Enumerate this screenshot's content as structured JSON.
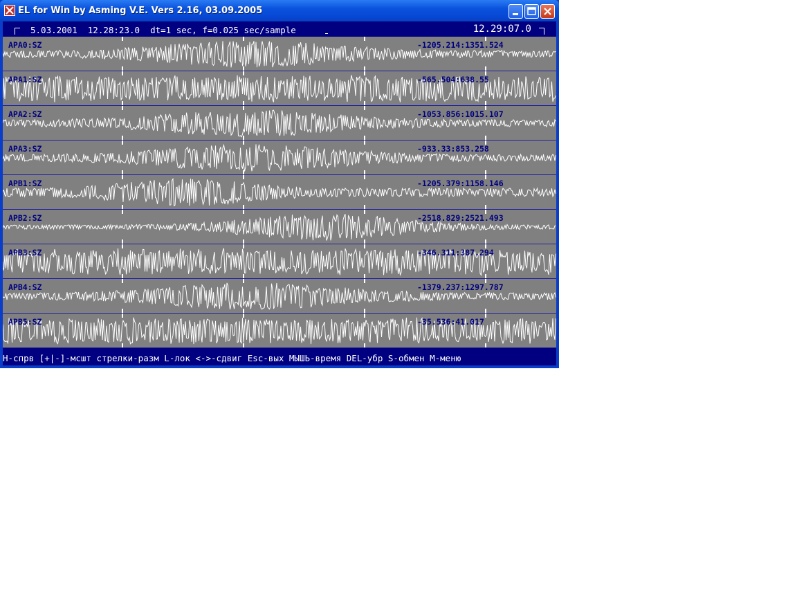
{
  "window": {
    "title": "EL for Win by Asming V.E. Vers 2.16, 03.09.2005"
  },
  "header": {
    "left": "5.03.2001  12.28:23.0  dt=1 sec, f=0.025 sec/sample",
    "right": "12.29:07.0"
  },
  "traces": [
    {
      "name": "APA0:SZ",
      "range": "-1205.214:1351.524",
      "envelope": "center"
    },
    {
      "name": "APA1:SZ",
      "range": "-565.504:638.55",
      "envelope": "uniform"
    },
    {
      "name": "APA2:SZ",
      "range": "-1053.856:1015.107",
      "envelope": "center"
    },
    {
      "name": "APA3:SZ",
      "range": "-933.33:853.258",
      "envelope": "center"
    },
    {
      "name": "APB1:SZ",
      "range": "-1205.379:1158.146",
      "envelope": "left"
    },
    {
      "name": "APB2:SZ",
      "range": "-2518.829:2521.493",
      "envelope": "right"
    },
    {
      "name": "APB3:SZ",
      "range": "-346.311:387.294",
      "envelope": "uniform"
    },
    {
      "name": "APB4:SZ",
      "range": "-1379.237:1297.787",
      "envelope": "center"
    },
    {
      "name": "APB5:SZ",
      "range": "-35.536:41.017",
      "envelope": "uniform"
    }
  ],
  "statusbar": {
    "text": "H-спрв [+|-]-мсшт стрелки-разм L-лок <->-сдвиг Esc-вых МЫШЬ-время DEL-убр S-обмен M-меню"
  },
  "colors": {
    "title_bar": "#0a52dd",
    "client_bg": "#000080",
    "trace_bg": "#808080",
    "waveform": "#ffffff",
    "label_text": "#000080"
  },
  "icons": {
    "app": "seismic-app-icon",
    "minimize": "minimize-icon",
    "maximize": "maximize-icon",
    "close": "close-icon"
  }
}
